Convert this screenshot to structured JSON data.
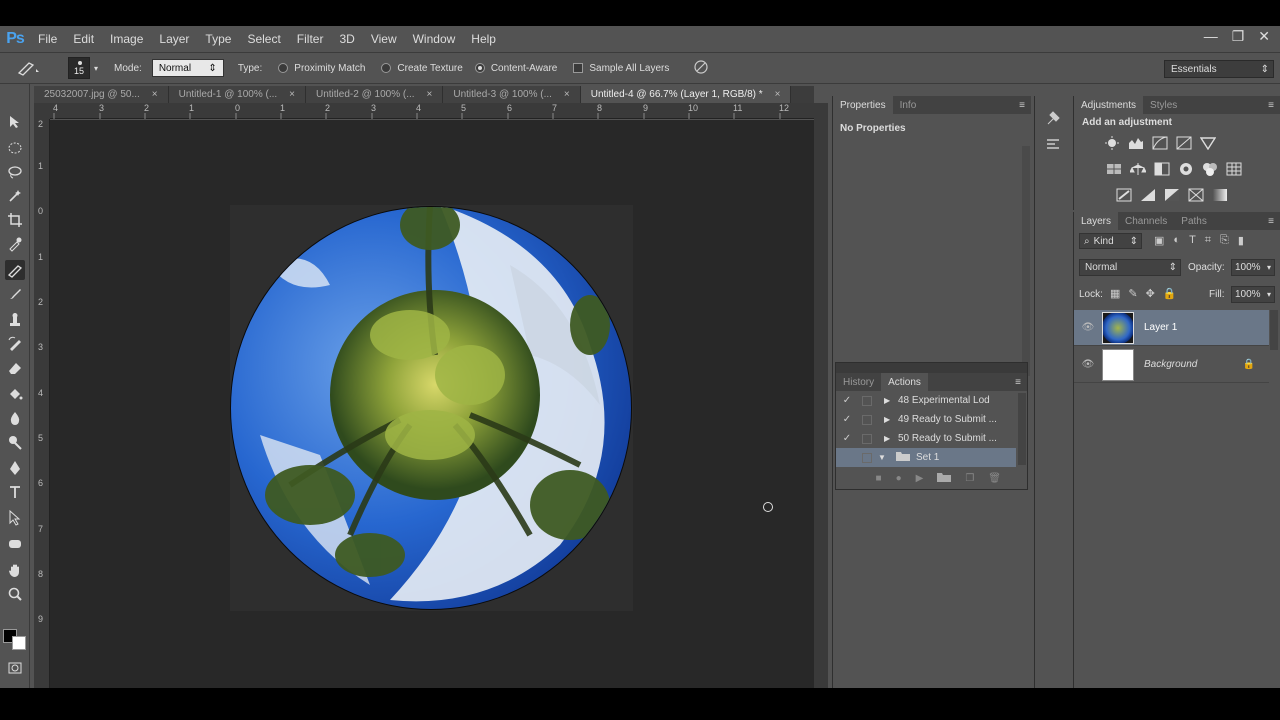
{
  "app": {
    "logo": "Ps"
  },
  "menu": [
    "File",
    "Edit",
    "Image",
    "Layer",
    "Type",
    "Select",
    "Filter",
    "3D",
    "View",
    "Window",
    "Help"
  ],
  "window_controls": {
    "minimize": "—",
    "restore": "❐",
    "close": "✕"
  },
  "options": {
    "brush_size": "15",
    "mode_label": "Mode:",
    "mode_value": "Normal",
    "type_label": "Type:",
    "proximity": "Proximity Match",
    "create_texture": "Create Texture",
    "content_aware": "Content-Aware",
    "sample_all": "Sample All Layers",
    "workspace": "Essentials"
  },
  "tabs": [
    {
      "label": "25032007.jpg @ 50...",
      "active": false
    },
    {
      "label": "Untitled-1 @ 100% (...",
      "active": false
    },
    {
      "label": "Untitled-2 @ 100% (...",
      "active": false
    },
    {
      "label": "Untitled-3 @ 100% (...",
      "active": false
    },
    {
      "label": "Untitled-4 @ 66.7% (Layer 1, RGB/8) *",
      "active": true
    }
  ],
  "tab_close": "×",
  "ruler_top": [
    "4",
    "3",
    "2",
    "1",
    "0",
    "1",
    "2",
    "3",
    "4",
    "5",
    "6",
    "7",
    "8",
    "9",
    "10",
    "11",
    "12"
  ],
  "ruler_left": [
    "2",
    "1",
    "0",
    "1",
    "2",
    "3",
    "4",
    "5",
    "6",
    "7",
    "8",
    "9"
  ],
  "properties": {
    "tab1": "Properties",
    "tab2": "Info",
    "body": "No Properties"
  },
  "history": {
    "tab1": "History",
    "tab2": "Actions",
    "rows": [
      {
        "label": "48 Experimental Lod",
        "check": "✓"
      },
      {
        "label": "49 Ready to Submit ...",
        "check": "✓"
      },
      {
        "label": "50 Ready to Submit ...",
        "check": "✓"
      },
      {
        "label": "Set 1",
        "check": ""
      }
    ]
  },
  "adjustments": {
    "tab1": "Adjustments",
    "tab2": "Styles",
    "title": "Add an adjustment"
  },
  "layers": {
    "tab1": "Layers",
    "tab2": "Channels",
    "tab3": "Paths",
    "kind": "Kind",
    "blend": "Normal",
    "opacity_label": "Opacity:",
    "opacity": "100%",
    "lock_label": "Lock:",
    "fill_label": "Fill:",
    "fill": "100%",
    "items": [
      {
        "name": "Layer 1",
        "selected": true
      },
      {
        "name": "Background",
        "selected": false
      }
    ]
  }
}
